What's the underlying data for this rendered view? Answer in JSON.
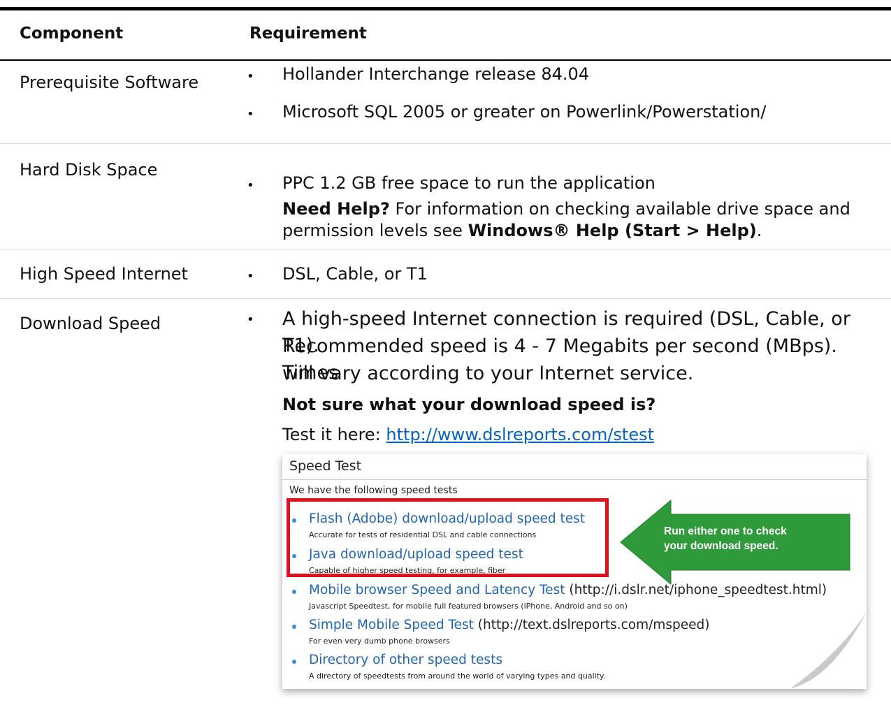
{
  "table": {
    "headers": {
      "component": "Component",
      "requirement": "Requirement"
    },
    "bullet": "•",
    "rows": [
      {
        "component": "Prerequisite Software",
        "requirements": [
          "Hollander Interchange release 84.04",
          "Microsoft SQL 2005 or greater on Powerlink/Powerstation/"
        ]
      },
      {
        "component": "Hard Disk Space",
        "requirements": [
          "PPC 1.2 GB free space to run the application"
        ],
        "help": {
          "bold_label": "Need Help?",
          "text1": " For information on checking available drive space and permission levels see ",
          "bold_link": "Windows® Help (Start > Help)",
          "text2": "."
        }
      },
      {
        "component": "High Speed Internet",
        "requirements": [
          "DSL, Cable, or T1"
        ]
      },
      {
        "component": "Download Speed",
        "requirements": [
          "A high-speed Internet connection is required (DSL, Cable, or T1).",
          "Recommended speed is 4 - 7 Megabits per second (MBps). Times",
          "will vary according to your Internet service."
        ],
        "question": "Not sure what your download speed is?",
        "test_prefix": "Test it here: ",
        "test_url": "http://www.dslreports.com/stest"
      }
    ]
  },
  "speed_test": {
    "title": "Speed Test",
    "intro": "We have the following speed tests",
    "items": [
      {
        "label": "Flash (Adobe) download/upload speed test",
        "url": "",
        "desc": "Accurate for tests of residential DSL and cable connections"
      },
      {
        "label": "Java download/upload speed test",
        "url": "",
        "desc": "Capable of higher speed testing, for example, fiber"
      },
      {
        "label": "Mobile browser Speed and Latency Test",
        "url": " (http://i.dslr.net/iphone_speedtest.html)",
        "desc": "Javascript Speedtest, for mobile full featured browsers (iPhone, Android and so on)"
      },
      {
        "label": "Simple Mobile Speed Test",
        "url": " (http://text.dslreports.com/mspeed)",
        "desc": "For even very dumb phone browsers"
      },
      {
        "label": "Directory of other speed tests",
        "url": "",
        "desc": "A directory of speedtests from around the world of varying types and quality."
      }
    ],
    "callout": {
      "line1": "Run either one to check",
      "line2": "your download speed."
    }
  },
  "colors": {
    "link": "#0563c1",
    "callout_green": "#2e9a3a",
    "highlight_red": "#e0101e",
    "bullet_blue": "#3a8fd9"
  }
}
